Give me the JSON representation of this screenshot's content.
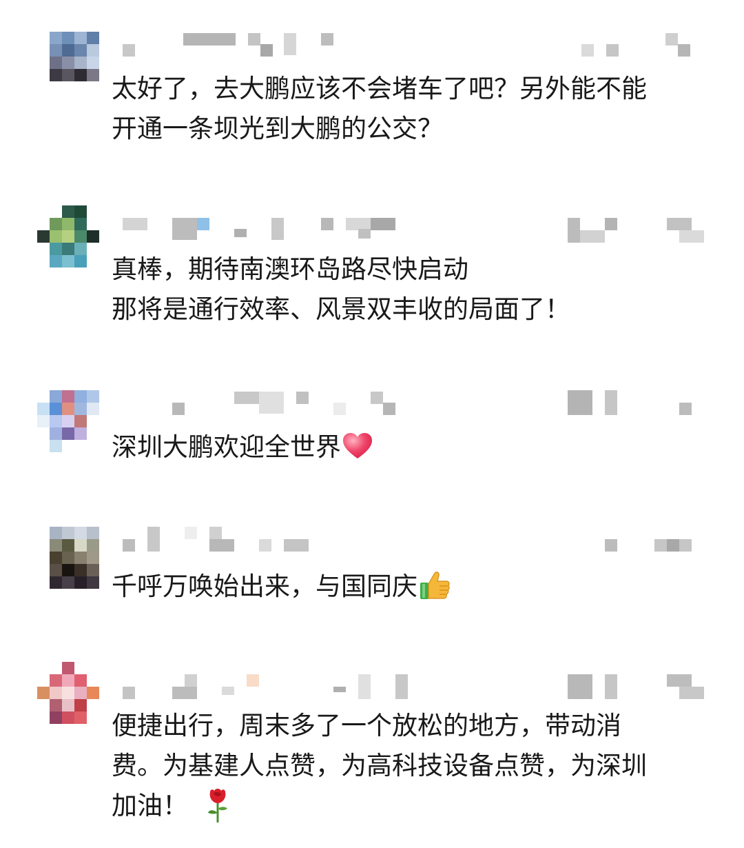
{
  "comments": [
    {
      "author": "",
      "meta": "",
      "text": "太好了，去大鹏应该不会堵车了吧？另外能不能\n开通一条坝光到大鹏的公交？",
      "emoji": ""
    },
    {
      "author": "",
      "meta": "",
      "text": "真棒，期待南澳环岛路尽快启动\n那将是通行效率、风景双丰收的局面了！",
      "emoji": ""
    },
    {
      "author": "",
      "meta": "",
      "text": "深圳大鹏欢迎全世界",
      "emoji": "heart-icon"
    },
    {
      "author": "",
      "meta": "",
      "text": "千呼万唤始出来，与国同庆",
      "emoji": "thumbs-up-icon"
    },
    {
      "author": "",
      "meta": "",
      "text": "便捷出行，周末多了一个放松的地方，带动消\n费。为基建人点赞，为高科技设备点赞，为深圳\n加油！",
      "emoji": "rose-icon"
    }
  ],
  "colors": {
    "text": "#191919",
    "heart": "#f0456a",
    "thumb": "#f4b73a",
    "cuff": "#3fae49",
    "rose": "#d91f2b",
    "leaf": "#4a8f2e"
  }
}
